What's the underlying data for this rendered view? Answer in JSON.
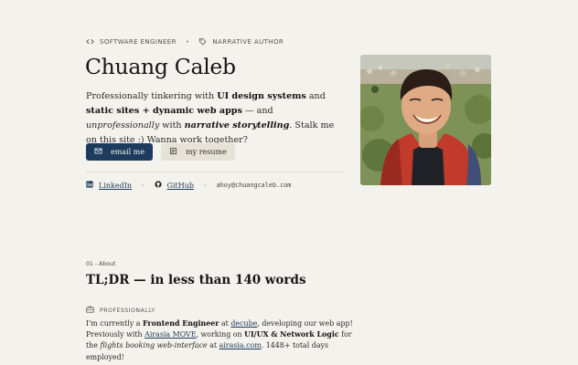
{
  "header": {
    "role_1": "SOFTWARE ENGINEER",
    "role_2": "NARRATIVE AUTHOR",
    "role_1_icon": "code-icon",
    "role_2_icon": "tag-icon",
    "name": "Chuang Caleb"
  },
  "intro": {
    "t1": "Professionally tinkering with ",
    "b1": "UI design systems",
    "t2": " and ",
    "b2": "static sites + dynamic web apps",
    "t3": " — and ",
    "i1": "unprofessionally",
    "t4": " with ",
    "bi1": "narrative storytelling",
    "t5": ". Stalk me on this site :) Wanna work together?"
  },
  "buttons": {
    "email_label": "email me",
    "resume_label": "my resume"
  },
  "links": {
    "linkedin": "LinkedIn",
    "github": "GitHub",
    "email": "ahoy@chuangcaleb.com"
  },
  "about": {
    "kicker": "01 - About",
    "title": "TL;DR — in less than 140 words",
    "sub_label": "PROFESSIONALLY",
    "p1": "I'm currently a ",
    "p_b1": "Frontend Engineer",
    "p2": " at ",
    "p_a1": "decube",
    "p3": ", developing our web app! Previously with ",
    "p_a2": "Airasia MOVE",
    "p4": ", working on ",
    "p_b2": "UI/UX & Network Logic",
    "p5": " for the ",
    "p_i1": "flights booking web-interface",
    "p6": " at ",
    "p_a3": "airasia.com",
    "p7": ". 1448+ total days employed!"
  },
  "colors": {
    "background": "#f4f2ec",
    "primary_button": "#1d3b5c",
    "secondary_button": "#e6e2d8",
    "link": "#1d3b5c"
  }
}
